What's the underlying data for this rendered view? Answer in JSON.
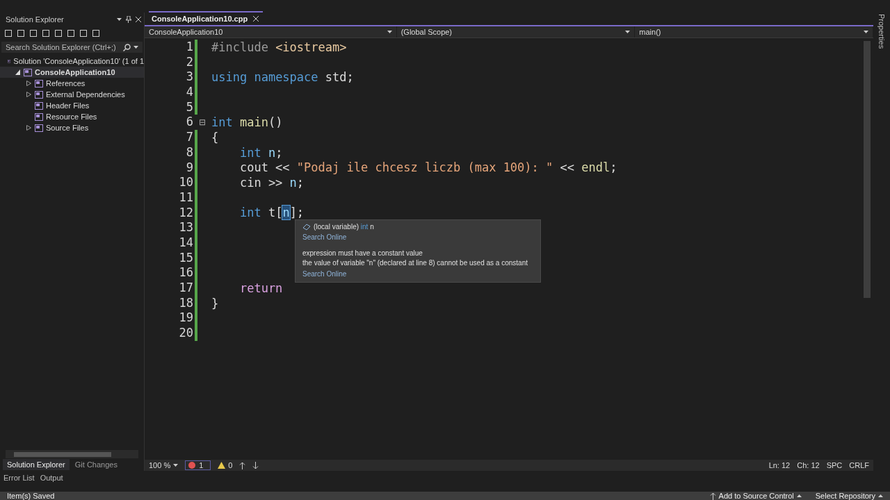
{
  "solution_explorer": {
    "title": "Solution Explorer",
    "search": {
      "placeholder": "Search Solution Explorer (Ctrl+;)"
    },
    "tree": [
      {
        "label": "Solution 'ConsoleApplication10' (1 of 1",
        "expandable": false,
        "expanded": true,
        "selected": false,
        "children": [
          {
            "label": "ConsoleApplication10",
            "expandable": true,
            "expanded": true,
            "selected": true,
            "children": [
              {
                "label": "References",
                "expandable": true,
                "expanded": false,
                "selected": false
              },
              {
                "label": "External Dependencies",
                "expandable": true,
                "expanded": false,
                "selected": false
              },
              {
                "label": "Header Files",
                "expandable": false,
                "selected": false
              },
              {
                "label": "Resource Files",
                "expandable": false,
                "selected": false
              },
              {
                "label": "Source Files",
                "expandable": true,
                "expanded": false,
                "selected": false
              }
            ]
          }
        ]
      }
    ],
    "tabs": [
      {
        "label": "Solution Explorer",
        "selected": true
      },
      {
        "label": "Git Changes",
        "selected": false
      }
    ]
  },
  "editor": {
    "tab": {
      "label": "ConsoleApplication10.cpp",
      "selected": true
    },
    "nav": {
      "project": "ConsoleApplication10",
      "scope": "(Global Scope)",
      "member": "main()"
    },
    "lines": [
      {
        "number": "1",
        "changed": true,
        "tokens": [
          {
            "kind": "pre",
            "text": "#include "
          },
          {
            "kind": "inc",
            "text": "<iostream>"
          }
        ]
      },
      {
        "number": "2",
        "changed": true
      },
      {
        "number": "3",
        "changed": true,
        "tokens": [
          {
            "kind": "kw",
            "text": "using"
          },
          {
            "kind": "kw",
            "text": " namespace"
          },
          {
            "kind": "plain",
            "text": " std;"
          }
        ]
      },
      {
        "number": "4",
        "changed": true
      },
      {
        "number": "5",
        "changed": true
      },
      {
        "number": "6",
        "changed": false,
        "fold": "⊟",
        "tokens": [
          {
            "kind": "kw",
            "text": "int"
          },
          {
            "kind": "fn",
            "text": " main"
          },
          {
            "kind": "plain",
            "text": "()"
          }
        ]
      },
      {
        "number": "7",
        "changed": true,
        "tokens": [
          {
            "kind": "plain",
            "text": "{"
          }
        ]
      },
      {
        "number": "8",
        "changed": true,
        "tokens": [
          {
            "kind": "kw",
            "text": "    int"
          },
          {
            "kind": "var",
            "text": " n"
          },
          {
            "kind": "plain",
            "text": ";"
          }
        ]
      },
      {
        "number": "9",
        "changed": true,
        "tokens": [
          {
            "kind": "plain",
            "text": "    cout << "
          },
          {
            "kind": "str",
            "text": "\"Podaj ile chcesz liczb (max 100): \""
          },
          {
            "kind": "plain",
            "text": " << "
          },
          {
            "kind": "fn",
            "text": "endl"
          },
          {
            "kind": "plain",
            "text": ";"
          }
        ]
      },
      {
        "number": "10",
        "changed": true,
        "tokens": [
          {
            "kind": "plain",
            "text": "    cin >> "
          },
          {
            "kind": "var",
            "text": "n"
          },
          {
            "kind": "plain",
            "text": ";"
          }
        ]
      },
      {
        "number": "11",
        "changed": true
      },
      {
        "number": "12",
        "changed": true,
        "tokens": [
          {
            "kind": "kw",
            "text": "    int"
          },
          {
            "kind": "plain",
            "text": " t["
          },
          {
            "kind": "hl",
            "text": "n"
          },
          {
            "kind": "plain",
            "text": "];"
          }
        ]
      },
      {
        "number": "13",
        "changed": true
      },
      {
        "number": "14",
        "changed": true
      },
      {
        "number": "15",
        "changed": true
      },
      {
        "number": "16",
        "changed": true
      },
      {
        "number": "17",
        "changed": true,
        "tokens": [
          {
            "kind": "ctl",
            "text": "    return"
          }
        ]
      },
      {
        "number": "18",
        "changed": true,
        "tokens": [
          {
            "kind": "plain",
            "text": "}"
          }
        ]
      },
      {
        "number": "19",
        "changed": true
      },
      {
        "number": "20",
        "changed": true
      }
    ],
    "tooltip": {
      "signature": [
        {
          "kind": "plain",
          "text": "(local variable) "
        },
        {
          "kind": "type",
          "text": "int"
        },
        {
          "kind": "plain",
          "text": " n"
        }
      ],
      "link1": "Search Online",
      "message": [
        "expression must have a constant value",
        "the value of variable \"n\" (declared at line 8) cannot be used as a constant"
      ],
      "link2": "Search Online"
    },
    "bottom_bar": {
      "zoom": "100 %",
      "errors": "1",
      "warnings": "0",
      "line": "Ln: 12",
      "column": "Ch: 12",
      "indent": "SPC",
      "eol": "CRLF"
    }
  },
  "properties_tab": "Properties",
  "output_tabs": [
    "Error List",
    "Output"
  ],
  "status_bar": {
    "message": "Item(s) Saved",
    "source_control": "Add to Source Control",
    "repository": "Select Repository"
  }
}
